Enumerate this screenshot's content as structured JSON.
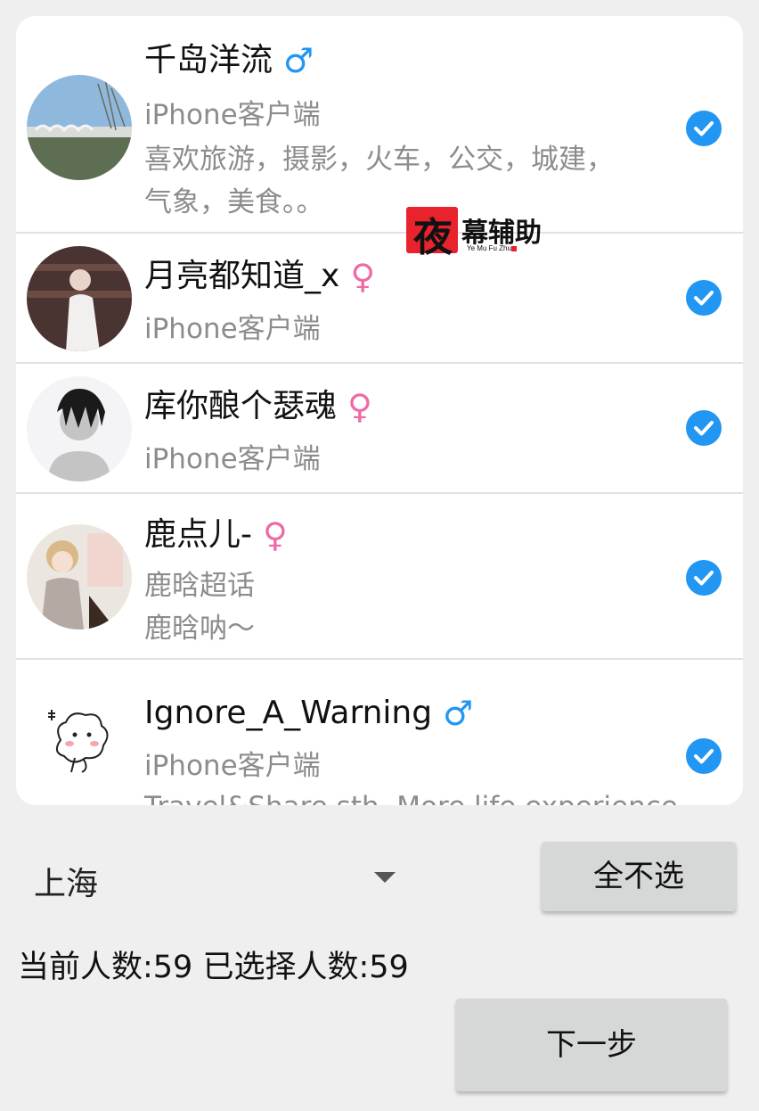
{
  "friends": [
    {
      "name": "千岛洋流",
      "gender": "♂",
      "gender_type": "male",
      "line1": "iPhone客户端",
      "line2": "喜欢旅游，摄影，火车，公交，城建，",
      "line3": "气象，美食。。",
      "checked": true
    },
    {
      "name": "月亮都知道_x",
      "gender": "♀",
      "gender_type": "female",
      "line1": "iPhone客户端",
      "checked": true
    },
    {
      "name": "库你酿个瑟魂",
      "gender": "♀",
      "gender_type": "female",
      "line1": "iPhone客户端",
      "checked": true
    },
    {
      "name": "鹿点儿-",
      "gender": "♀",
      "gender_type": "female",
      "line1": "鹿晗超话",
      "line2": "鹿晗呐～",
      "checked": true
    },
    {
      "name": "Ignore_A_Warning",
      "gender": "♂",
      "gender_type": "male",
      "line1": "iPhone客户端",
      "line2": "Travel&Share sth. More life experience",
      "checked": true
    }
  ],
  "watermark": {
    "char": "夜",
    "text": "幕辅助",
    "sub": "Ye Mu Fu Zhu"
  },
  "city": {
    "selected": "上海"
  },
  "buttons": {
    "deselect_all": "全不选",
    "next": "下一步"
  },
  "status": {
    "text": "当前人数:59 已选择人数:59"
  },
  "colors": {
    "accent": "#2196f3",
    "female": "#ee6aa7",
    "background": "#efefef"
  }
}
